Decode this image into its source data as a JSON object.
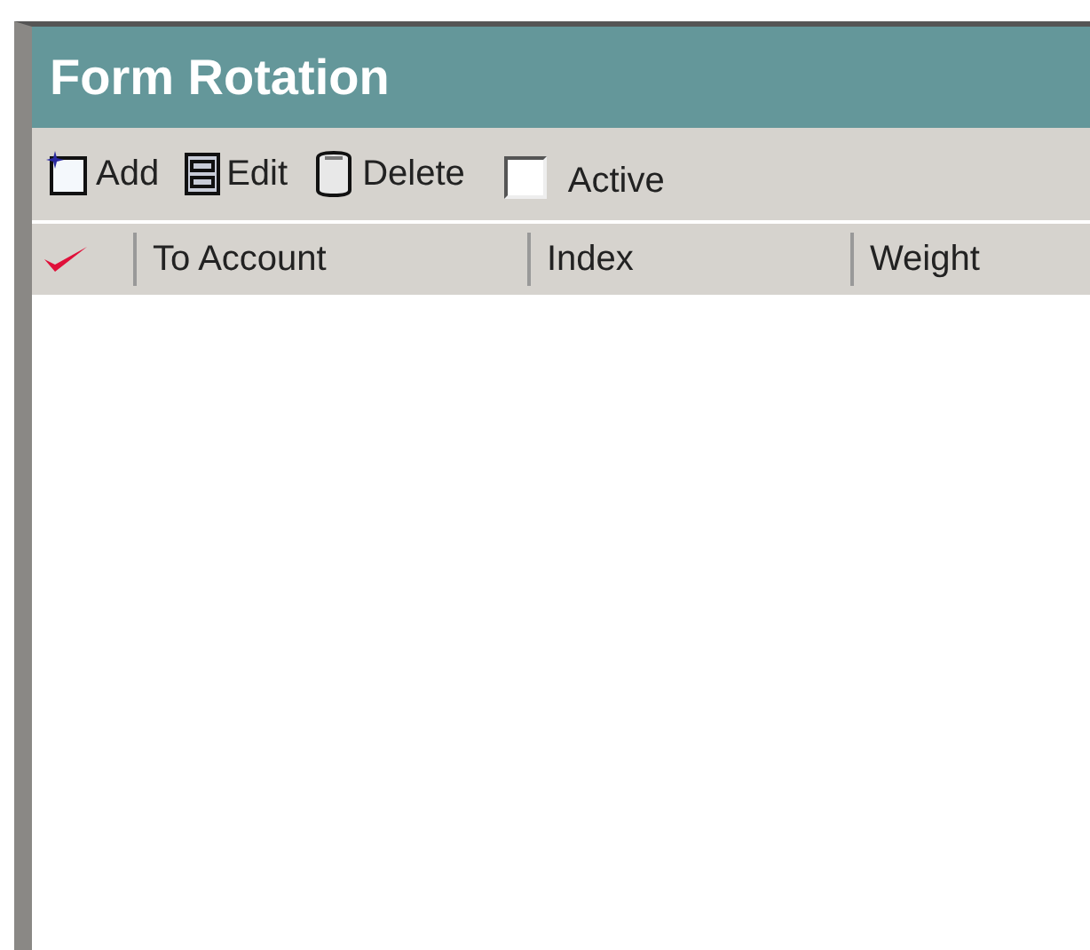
{
  "title": "Form Rotation",
  "toolbar": [
    {
      "kind": "add",
      "label": "Add"
    },
    {
      "kind": "edit",
      "label": "Edit"
    },
    {
      "kind": "delete",
      "label": "Delete"
    },
    {
      "kind": "checkbox",
      "label": "Active",
      "checked": false
    }
  ],
  "table": {
    "columns": [
      "To Account",
      "Index",
      "Weight"
    ]
  }
}
